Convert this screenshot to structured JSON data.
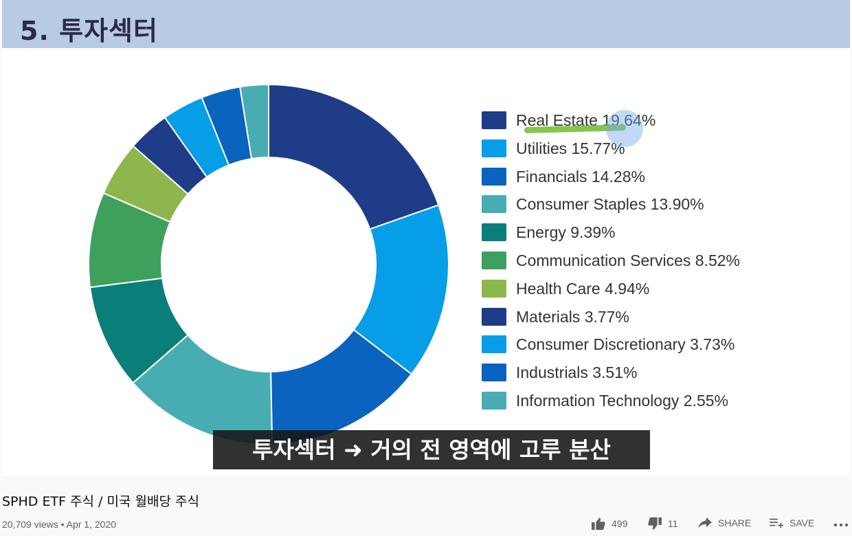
{
  "slide": {
    "title": "5. 투자섹터",
    "subtitle": "투자섹터 ➜ 거의 전 영역에 고루 분산"
  },
  "chart_data": {
    "type": "pie",
    "style": "donut",
    "legend_position": "right",
    "slices": [
      {
        "label": "Real Estate",
        "value": 19.64,
        "display": "Real Estate 19.64%",
        "color": "#1f3c88"
      },
      {
        "label": "Utilities",
        "value": 15.77,
        "display": "Utilities 15.77%",
        "color": "#079ee8"
      },
      {
        "label": "Financials",
        "value": 14.28,
        "display": "Financials 14.28%",
        "color": "#0a63bf"
      },
      {
        "label": "Consumer Staples",
        "value": 13.9,
        "display": "Consumer Staples 13.90%",
        "color": "#48adb3"
      },
      {
        "label": "Energy",
        "value": 9.39,
        "display": "Energy 9.39%",
        "color": "#0a7f79"
      },
      {
        "label": "Communication Services",
        "value": 8.52,
        "display": "Communication Services 8.52%",
        "color": "#3fa05d"
      },
      {
        "label": "Health Care",
        "value": 4.94,
        "display": "Health Care 4.94%",
        "color": "#8db74c"
      },
      {
        "label": "Materials",
        "value": 3.77,
        "display": "Materials 3.77%",
        "color": "#1f3c88"
      },
      {
        "label": "Consumer Discretionary",
        "value": 3.73,
        "display": "Consumer Discretionary 3.73%",
        "color": "#079ee8"
      },
      {
        "label": "Industrials",
        "value": 3.51,
        "display": "Industrials 3.51%",
        "color": "#0a63bf"
      },
      {
        "label": "Information Technology",
        "value": 2.55,
        "display": "Information Technology 2.55%",
        "color": "#48adb3"
      }
    ]
  },
  "video": {
    "title": "SPHD ETF 주식 / 미국 월배당 주식",
    "views": "20,709 views",
    "separator": "•",
    "date": "Apr 1, 2020",
    "meta_line": "20,709 views • Apr 1, 2020"
  },
  "actions": {
    "like_count": "499",
    "dislike_count": "11",
    "share_label": "SHARE",
    "save_label": "SAVE",
    "icons": [
      "thumbs-up-icon",
      "thumbs-down-icon",
      "share-arrow-icon",
      "playlist-add-icon",
      "more-dots-icon"
    ]
  }
}
